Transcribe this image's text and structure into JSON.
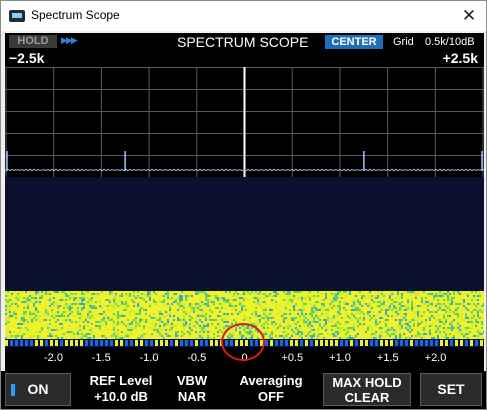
{
  "window": {
    "title": "Spectrum Scope",
    "close_glyph": "✕",
    "app_icon": "radio-icon"
  },
  "topbar": {
    "hold_label": "HOLD",
    "hold_arrow": "▶▶▶",
    "title": "SPECTRUM SCOPE",
    "mode": "CENTER",
    "grid_label": "Grid",
    "grid_value": "0.5k/10dB",
    "span_left": "−2.5k",
    "span_right": "+2.5k"
  },
  "colors": {
    "accent": "#1f6fb8",
    "trace": "#9fb8d8",
    "waterfall_high": "#f2f22a",
    "waterfall_low": "#0b1030",
    "marker": "#e01818"
  },
  "freq_axis": {
    "ticks": [
      "-2.0",
      "-1.5",
      "-1.0",
      "-0.5",
      "0",
      "+0.5",
      "+1.0",
      "+1.5",
      "+2.0"
    ]
  },
  "spectrum": {
    "peaks_khz": [
      -2.5,
      -1.25,
      1.25,
      2.5
    ]
  },
  "bottom": {
    "on_label": "ON",
    "ref_label": "REF Level",
    "ref_value": "+10.0 dB",
    "vbw_label": "VBW",
    "vbw_value": "NAR",
    "avg_label": "Averaging",
    "avg_value": "OFF",
    "maxhold_line1": "MAX HOLD",
    "maxhold_line2": "CLEAR",
    "set_label": "SET"
  }
}
